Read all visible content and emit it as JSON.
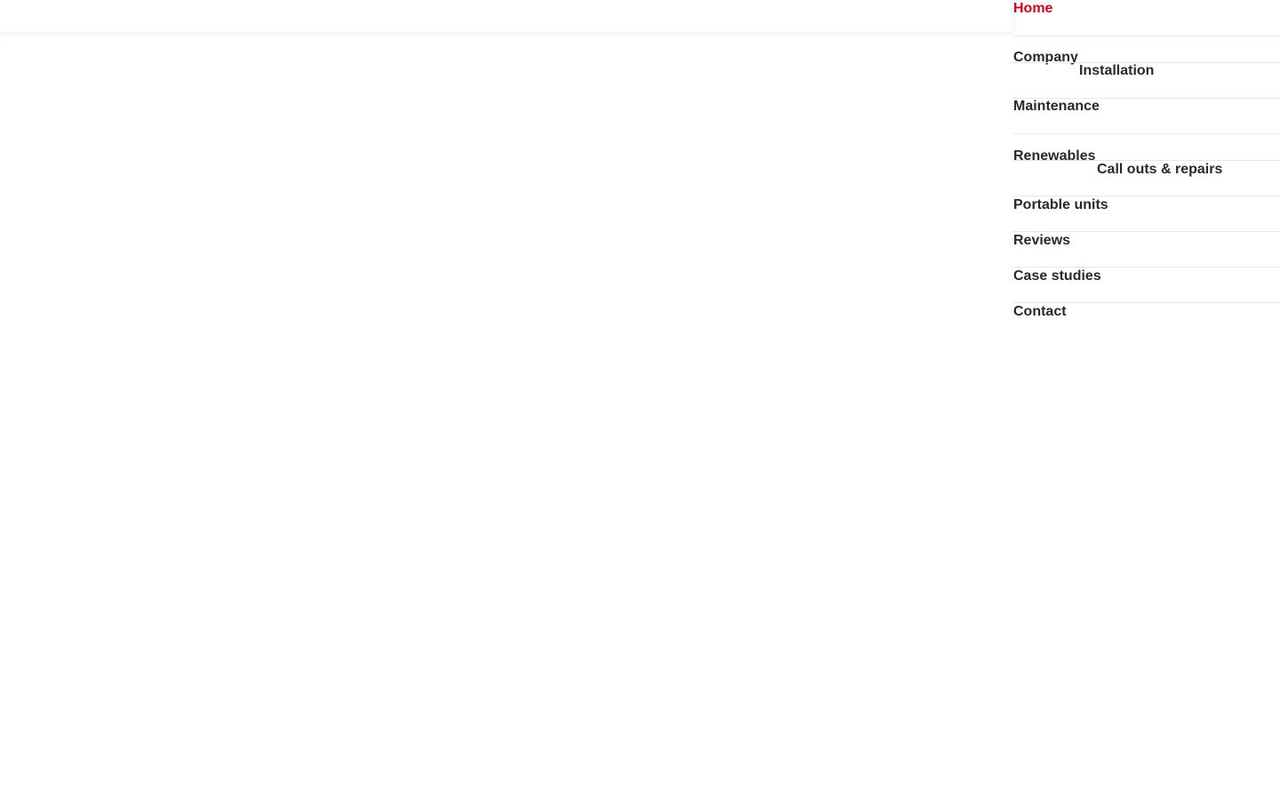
{
  "nav": {
    "active_color": "#d0021b",
    "text_color": "#2a2a2a",
    "items": [
      {
        "label": "Home",
        "active": true
      },
      {
        "label": "Company"
      },
      {
        "label": "Installation"
      },
      {
        "label": "Maintenance"
      },
      {
        "label": "Renewables"
      },
      {
        "label": "Call outs & repairs"
      },
      {
        "label": "Portable units"
      },
      {
        "label": "Reviews"
      },
      {
        "label": "Case studies"
      },
      {
        "label": "Contact"
      }
    ]
  }
}
